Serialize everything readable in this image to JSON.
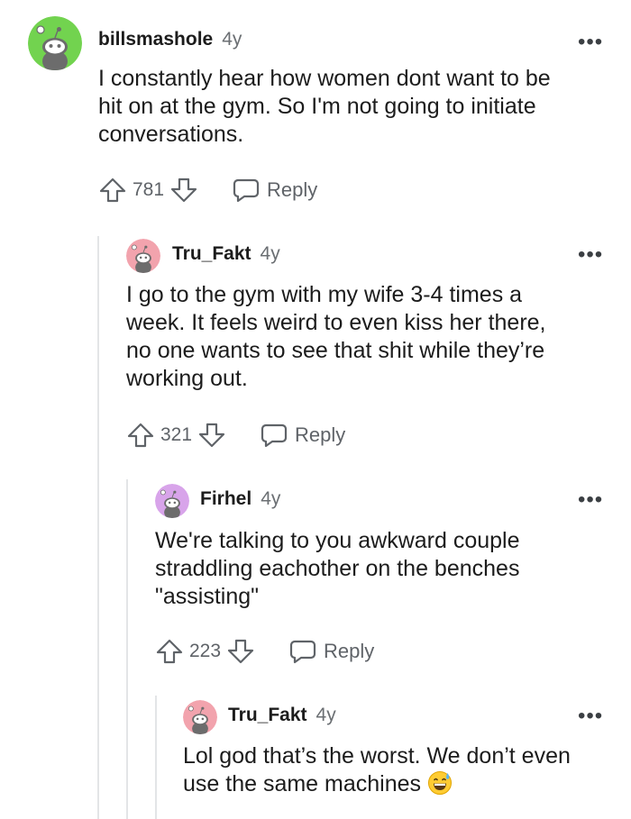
{
  "comments": [
    {
      "username": "billsmashole",
      "age": "4y",
      "avatar_color": "#72d34f",
      "body_lines": [
        "I constantly hear how women dont want to be",
        "hit on at the gym. So I'm not going to initiate",
        "conversations."
      ],
      "score": "781",
      "reply_label": "Reply",
      "more_label": "•••"
    },
    {
      "username": "Tru_Fakt",
      "age": "4y",
      "avatar_color": "#f2a3ad",
      "body_lines": [
        "I go to the gym with my wife 3-4 times a",
        "week. It feels weird to even kiss her there,",
        "no one wants to see that shit while they’re",
        "working out."
      ],
      "score": "321",
      "reply_label": "Reply",
      "more_label": "•••"
    },
    {
      "username": "Firhel",
      "age": "4y",
      "avatar_color": "#d8a4ea",
      "body_lines": [
        "We're talking to you awkward couple",
        "straddling eachother on the benches",
        "\"assisting\""
      ],
      "score": "223",
      "reply_label": "Reply",
      "more_label": "•••"
    },
    {
      "username": "Tru_Fakt",
      "age": "4y",
      "avatar_color": "#f2a3ad",
      "body_lines": [
        "Lol god that’s the worst. We don’t even",
        "use the same machines"
      ],
      "more_label": "•••"
    }
  ]
}
